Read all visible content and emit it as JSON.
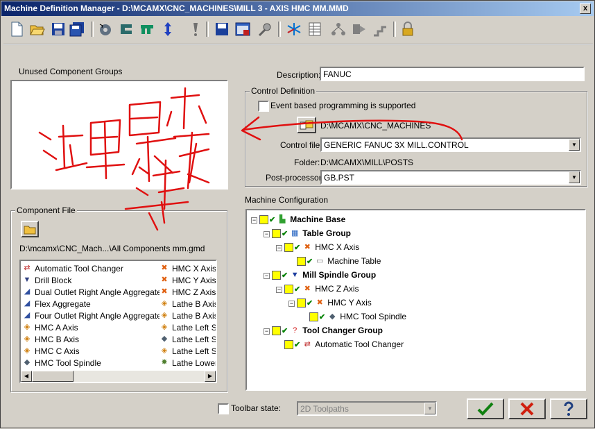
{
  "window": {
    "title": "Machine Definition Manager - D:\\MCAMX\\CNC_MACHINES\\MILL 3 - AXIS HMC MM.MMD",
    "close_label": "x"
  },
  "toolbar": {
    "icons": [
      "new-file-icon",
      "open-folder-icon",
      "save-icon",
      "save-as-icon",
      "machine-rotate-icon",
      "component-c-icon",
      "component-u-icon",
      "axis-component-icon",
      "warning-exclamation-icon",
      "save-blue-icon",
      "properties-icon",
      "wrench-icon",
      "axes-icon",
      "table-icon",
      "tree-icon",
      "arrow-right-icon",
      "steps-icon",
      "lock-icon"
    ]
  },
  "unused_groups": {
    "label": "Unused Component Groups"
  },
  "component_file": {
    "label": "Component File",
    "path": "D:\\mcamx\\CNC_Mach...\\All Components mm.gmd",
    "col1": [
      {
        "icon": "tool-changer-icon",
        "label": "Automatic Tool Changer"
      },
      {
        "icon": "drill-block-icon",
        "label": "Drill Block"
      },
      {
        "icon": "aggregate-icon",
        "label": "Dual Outlet Right Angle Aggregate"
      },
      {
        "icon": "aggregate-icon",
        "label": "Flex Aggregate"
      },
      {
        "icon": "aggregate-icon",
        "label": "Four Outlet Right Angle Aggregate"
      },
      {
        "icon": "rotary-axis-icon",
        "label": "HMC A Axis"
      },
      {
        "icon": "rotary-axis-icon",
        "label": "HMC B Axis"
      },
      {
        "icon": "rotary-axis-icon",
        "label": "HMC C Axis"
      },
      {
        "icon": "spindle-icon",
        "label": "HMC Tool Spindle"
      }
    ],
    "col2": [
      {
        "icon": "linear-axis-icon",
        "label": "HMC X Axis"
      },
      {
        "icon": "linear-axis-icon",
        "label": "HMC Y Axis"
      },
      {
        "icon": "linear-axis-icon",
        "label": "HMC Z Axis"
      },
      {
        "icon": "rotary-axis-icon",
        "label": "Lathe B Axis /"
      },
      {
        "icon": "rotary-axis-icon",
        "label": "Lathe B Axis"
      },
      {
        "icon": "rotary-axis-icon",
        "label": "Lathe Left Sp"
      },
      {
        "icon": "spindle-icon",
        "label": "Lathe Left Sp"
      },
      {
        "icon": "rotary-axis-icon",
        "label": "Lathe Left Sp"
      },
      {
        "icon": "turret-icon",
        "label": "Lathe Lower T"
      }
    ]
  },
  "description": {
    "label": "Description:",
    "value": "FANUC"
  },
  "control_definition": {
    "label": "Control Definition",
    "event_based_label": "Event based programming is supported",
    "path": "D:\\MCAMX\\CNC_MACHINES",
    "control_file_label": "Control file:",
    "control_file_value": "GENERIC FANUC 3X MILL.CONTROL",
    "folder_label": "Folder:",
    "folder_value": "D:\\MCAMX\\MILL\\POSTS",
    "post_label": "Post-processor:",
    "post_value": "GB.PST"
  },
  "machine_config": {
    "label": "Machine Configuration",
    "nodes": [
      {
        "label": "Machine Base",
        "bold": true,
        "icon": "machine-base-icon"
      },
      {
        "label": "Table Group",
        "bold": true,
        "icon": "table-group-icon"
      },
      {
        "label": "HMC X Axis",
        "bold": false,
        "icon": "linear-axis-icon"
      },
      {
        "label": "Machine Table",
        "bold": false,
        "icon": "machine-table-icon"
      },
      {
        "label": "Mill Spindle Group",
        "bold": true,
        "icon": "spindle-group-icon"
      },
      {
        "label": "HMC Z Axis",
        "bold": false,
        "icon": "linear-axis-icon"
      },
      {
        "label": "HMC Y Axis",
        "bold": false,
        "icon": "linear-axis-icon"
      },
      {
        "label": "HMC Tool Spindle",
        "bold": false,
        "icon": "spindle-icon"
      },
      {
        "label": "Tool Changer Group",
        "bold": true,
        "icon": "question-icon"
      },
      {
        "label": "Automatic Tool Changer",
        "bold": false,
        "icon": "tool-changer-icon"
      }
    ]
  },
  "bottom": {
    "toolbar_state_label": "Toolbar state:",
    "toolbar_state_value": "2D Toolpaths",
    "ok_icon": "checkmark-icon",
    "cancel_icon": "red-x-icon",
    "help_icon": "help-question-icon"
  },
  "annotation": {
    "color": "#e01010",
    "handwriting": "这里是不是进入"
  }
}
